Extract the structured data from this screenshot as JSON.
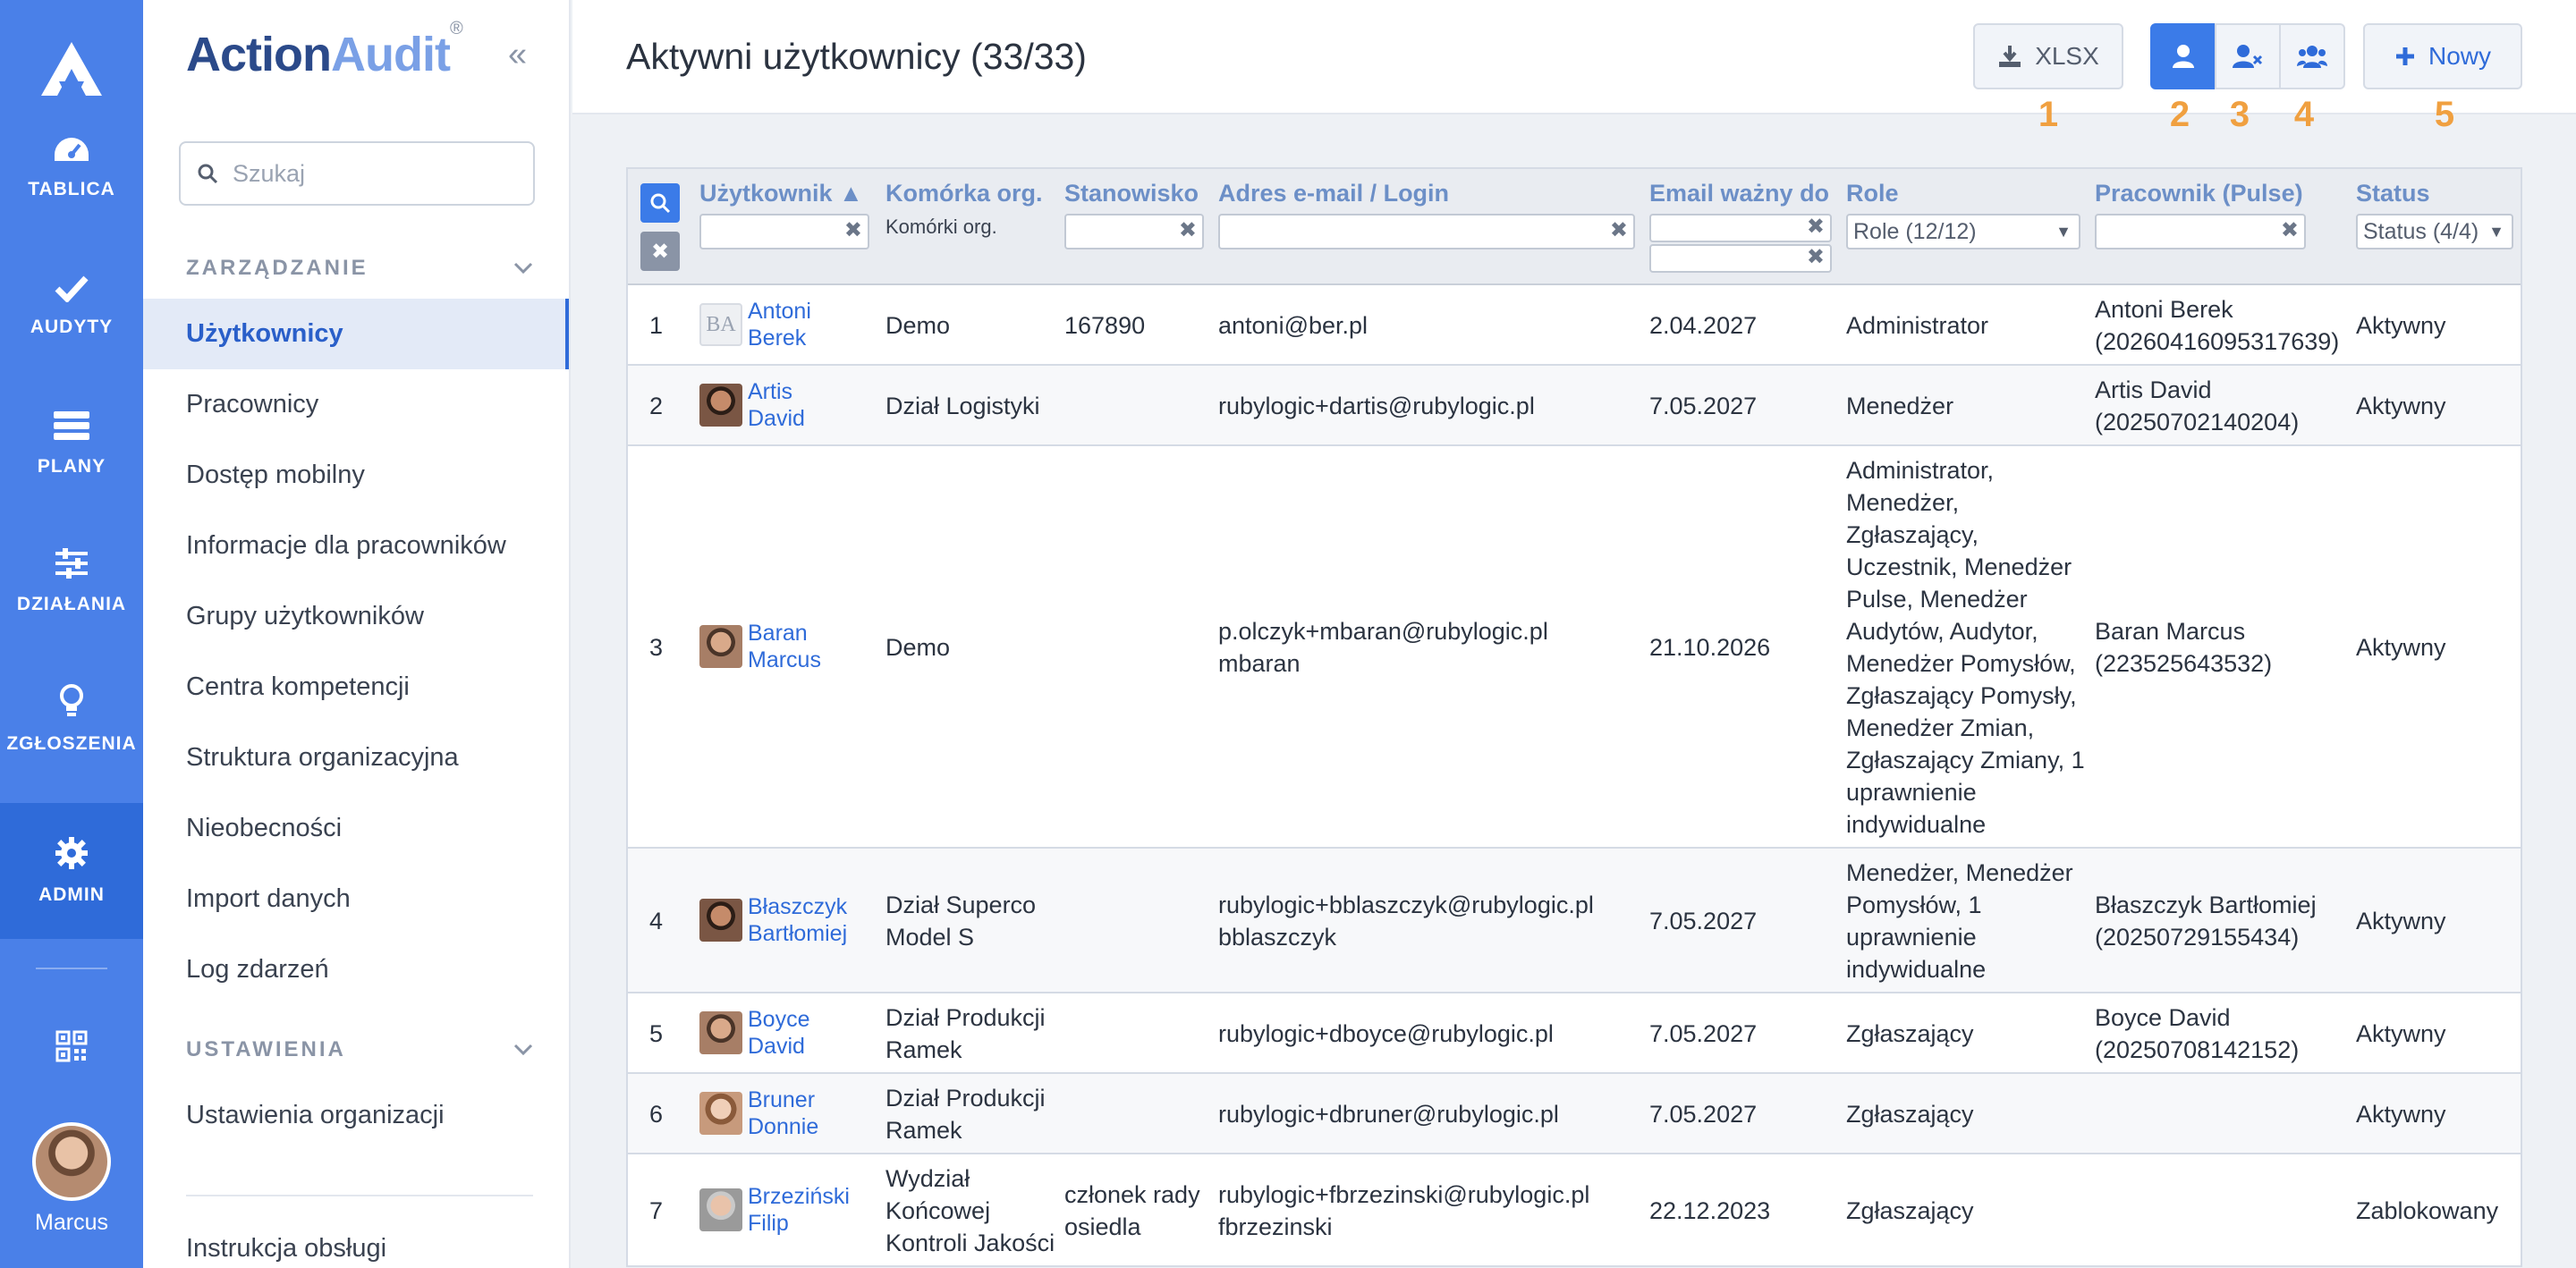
{
  "app": {
    "brand_a": "Action",
    "brand_b": "Audit",
    "brand_reg": "®"
  },
  "rail": {
    "items": [
      {
        "label": "TABLICA",
        "icon": "dashboard-icon"
      },
      {
        "label": "AUDYTY",
        "icon": "check-icon"
      },
      {
        "label": "PLANY",
        "icon": "plans-icon"
      },
      {
        "label": "DZIAŁANIA",
        "icon": "sliders-icon"
      },
      {
        "label": "ZGŁOSZENIA",
        "icon": "lightbulb-icon"
      },
      {
        "label": "ADMIN",
        "icon": "gear-icon"
      }
    ],
    "user_name": "Marcus"
  },
  "nav": {
    "search_placeholder": "Szukaj",
    "section_management": "ZARZĄDZANIE",
    "items": [
      "Użytkownicy",
      "Pracownicy",
      "Dostęp mobilny",
      "Informacje dla pracowników",
      "Grupy użytkowników",
      "Centra kompetencji",
      "Struktura organizacyjna",
      "Nieobecności",
      "Import danych",
      "Log zdarzeń"
    ],
    "section_settings": "USTAWIENIA",
    "settings_items": [
      "Ustawienia organizacji"
    ],
    "footer_item": "Instrukcja obsługi"
  },
  "header": {
    "title": "Aktywni użytkownicy (33/33)",
    "xlsx_label": "XLSX",
    "new_label": "Nowy",
    "callouts": [
      "1",
      "2",
      "3",
      "4",
      "5"
    ]
  },
  "table": {
    "columns": {
      "user": "Użytkownik ▲",
      "unit": "Komórka org.",
      "unit_filter": "Komórki org.",
      "position": "Stanowisko",
      "email": "Adres e-mail / Login",
      "valid": "Email ważny do",
      "roles": "Role",
      "roles_filter": "Role (12/12)",
      "employee": "Pracownik (Pulse)",
      "status": "Status",
      "status_filter": "Status (4/4)"
    },
    "rows": [
      {
        "n": "1",
        "first": "Antoni",
        "last": "Berek",
        "initials": "BA",
        "unit": "Demo",
        "position": "167890",
        "email": "antoni@ber.pl",
        "login": "",
        "valid": "2.04.2027",
        "roles": "Administrator",
        "emp": "Antoni Berek",
        "emp_id": "(20260416095317639)",
        "status": "Aktywny"
      },
      {
        "n": "2",
        "first": "Artis",
        "last": "David",
        "unit": "Dział Logistyki",
        "position": "",
        "email": "rubylogic+dartis@rubylogic.pl",
        "login": "",
        "valid": "7.05.2027",
        "roles": "Menedżer",
        "emp": "Artis David",
        "emp_id": "(20250702140204)",
        "status": "Aktywny"
      },
      {
        "n": "3",
        "first": "Baran",
        "last": "Marcus",
        "unit": "Demo",
        "position": "",
        "email": "p.olczyk+mbaran@rubylogic.pl",
        "login": "mbaran",
        "valid": "21.10.2026",
        "roles": "Administrator, Menedżer, Zgłaszający, Uczestnik, Menedżer Pulse, Menedżer Audytów, Audytor, Menedżer Pomysłów, Zgłaszający Pomysły, Menedżer Zmian, Zgłaszający Zmiany, 1 uprawnienie indywidualne",
        "emp": "Baran Marcus",
        "emp_id": "(223525643532)",
        "status": "Aktywny"
      },
      {
        "n": "4",
        "first": "Błaszczyk",
        "last": "Bartłomiej",
        "unit": "Dział Superco Model S",
        "position": "",
        "email": "rubylogic+bblaszczyk@rubylogic.pl",
        "login": "bblaszczyk",
        "valid": "7.05.2027",
        "roles": "Menedżer, Menedżer Pomysłów, 1 uprawnienie indywidualne",
        "emp": "Błaszczyk Bartłomiej",
        "emp_id": "(20250729155434)",
        "status": "Aktywny"
      },
      {
        "n": "5",
        "first": "Boyce",
        "last": "David",
        "unit": "Dział Produkcji Ramek",
        "position": "",
        "email": "rubylogic+dboyce@rubylogic.pl",
        "login": "",
        "valid": "7.05.2027",
        "roles": "Zgłaszający",
        "emp": "Boyce David",
        "emp_id": "(20250708142152)",
        "status": "Aktywny"
      },
      {
        "n": "6",
        "first": "Bruner",
        "last": "Donnie",
        "unit": "Dział Produkcji Ramek",
        "position": "",
        "email": "rubylogic+dbruner@rubylogic.pl",
        "login": "",
        "valid": "7.05.2027",
        "roles": "Zgłaszający",
        "emp": "",
        "emp_id": "",
        "status": "Aktywny"
      },
      {
        "n": "7",
        "first": "Brzeziński",
        "last": "Filip",
        "unit": "Wydział Końcowej Kontroli Jakości",
        "position": "członek rady osiedla",
        "email": "rubylogic+fbrzezinski@rubylogic.pl",
        "login": "fbrzezinski",
        "valid": "22.12.2023",
        "roles": "Zgłaszający",
        "emp": "",
        "emp_id": "",
        "status": "Zablokowany"
      }
    ]
  }
}
